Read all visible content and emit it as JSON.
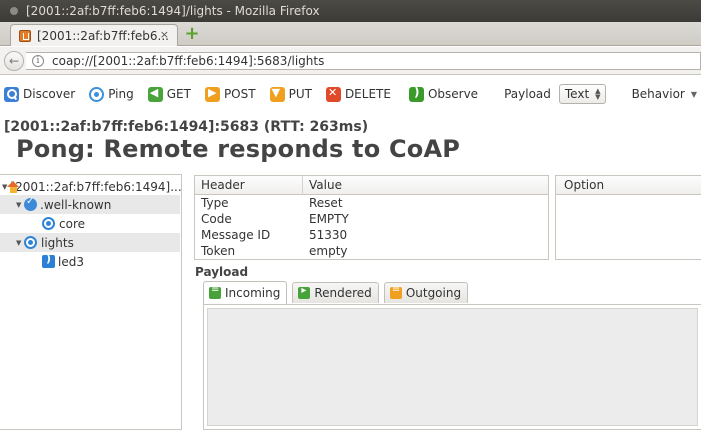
{
  "window": {
    "title": "[2001::2af:b7ff:feb6:1494]/lights - Mozilla Firefox"
  },
  "tab": {
    "label": "[2001::2af:b7ff:feb6...",
    "close": "×",
    "new_tab": "+"
  },
  "url": {
    "value": "coap://[2001::2af:b7ff:feb6:1494]:5683/lights",
    "back": "←",
    "info": "i"
  },
  "toolbar": {
    "discover": "Discover",
    "ping": "Ping",
    "get": "GET",
    "post": "POST",
    "put": "PUT",
    "delete": "DELETE",
    "observe": "Observe",
    "payload_label": "Payload",
    "payload_format": "Text",
    "behavior": "Behavior"
  },
  "remote": {
    "address_line": "[2001::2af:b7ff:feb6:1494]:5683 (RTT: 263ms)",
    "status": "Pong: Remote responds to CoAP"
  },
  "tree": {
    "root": "[2001::2af:b7ff:feb6:1494]...",
    "items": [
      {
        "label": ".well-known"
      },
      {
        "label": "core"
      },
      {
        "label": "lights"
      },
      {
        "label": "led3"
      }
    ]
  },
  "headers": {
    "col_header": "Header",
    "col_value": "Value",
    "rows": [
      {
        "name": "Type",
        "value": "Reset"
      },
      {
        "name": "Code",
        "value": "EMPTY"
      },
      {
        "name": "Message ID",
        "value": "51330"
      },
      {
        "name": "Token",
        "value": "empty"
      }
    ]
  },
  "options": {
    "col_option": "Option"
  },
  "payload": {
    "label": "Payload",
    "tabs": [
      {
        "label": "Incoming"
      },
      {
        "label": "Rendered"
      },
      {
        "label": "Outgoing"
      }
    ]
  },
  "colors": {
    "accent_blue": "#3c7fd6",
    "get_green": "#4aa33a",
    "post_orange": "#f0a020",
    "delete_red": "#e04a2a"
  }
}
